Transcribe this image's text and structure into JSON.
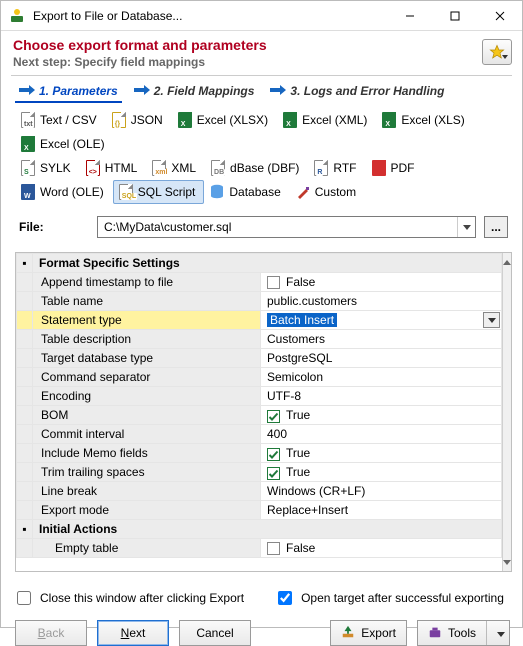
{
  "window": {
    "title": "Export to File or Database..."
  },
  "header": {
    "heading": "Choose export format and parameters",
    "subheading": "Next step: Specify field mappings"
  },
  "steps": [
    {
      "label": "1. Parameters",
      "active": true
    },
    {
      "label": "2. Field Mappings",
      "active": false
    },
    {
      "label": "3. Logs and Error Handling",
      "active": false
    }
  ],
  "formats": {
    "row1": [
      "Text / CSV",
      "JSON",
      "Excel (XLSX)",
      "Excel (XML)",
      "Excel (XLS)",
      "Excel (OLE)"
    ],
    "row2": [
      "SYLK",
      "HTML",
      "XML",
      "dBase (DBF)",
      "RTF",
      "PDF"
    ],
    "row3": [
      "Word (OLE)",
      "SQL Script",
      "Database",
      "Custom"
    ],
    "selected": "SQL Script"
  },
  "file": {
    "label": "File:",
    "value": "C:\\MyData\\customer.sql"
  },
  "grid": {
    "section1": "Format Specific Settings",
    "rows": [
      {
        "label": "Append timestamp to file",
        "type": "bool",
        "value": false,
        "text": "False"
      },
      {
        "label": "Table name",
        "type": "text",
        "text": "public.customers"
      },
      {
        "label": "Statement type",
        "type": "dropdown",
        "text": "Batch Insert",
        "highlighted": true
      },
      {
        "label": "Table description",
        "type": "text",
        "text": "Customers"
      },
      {
        "label": "Target database type",
        "type": "text",
        "text": "PostgreSQL"
      },
      {
        "label": "Command separator",
        "type": "text",
        "text": "Semicolon"
      },
      {
        "label": "Encoding",
        "type": "text",
        "text": "UTF-8"
      },
      {
        "label": "BOM",
        "type": "bool",
        "value": true,
        "text": "True"
      },
      {
        "label": "Commit interval",
        "type": "text",
        "text": "400"
      },
      {
        "label": "Include Memo fields",
        "type": "bool",
        "value": true,
        "text": "True"
      },
      {
        "label": "Trim trailing spaces",
        "type": "bool",
        "value": true,
        "text": "True"
      },
      {
        "label": "Line break",
        "type": "text",
        "text": "Windows (CR+LF)"
      },
      {
        "label": "Export mode",
        "type": "text",
        "text": "Replace+Insert"
      }
    ],
    "section2": "Initial Actions",
    "rows2": [
      {
        "label": "Empty table",
        "type": "bool",
        "value": false,
        "text": "False"
      }
    ]
  },
  "options": {
    "close_after": {
      "label": "Close this window after clicking Export",
      "checked": false
    },
    "open_target": {
      "label": "Open target after successful exporting",
      "checked": true
    }
  },
  "buttons": {
    "back": "Back",
    "next": "Next",
    "cancel": "Cancel",
    "export": "Export",
    "tools": "Tools"
  }
}
